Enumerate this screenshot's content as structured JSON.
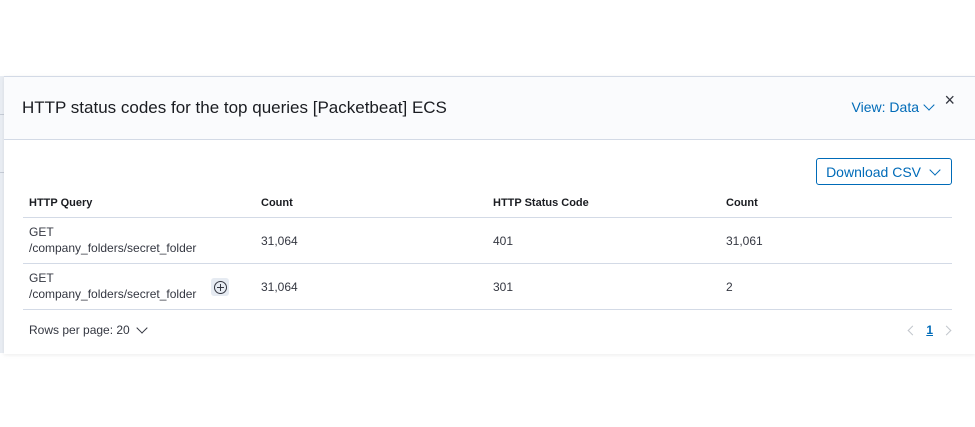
{
  "modal": {
    "title": "HTTP status codes for the top queries [Packetbeat] ECS",
    "view_toggle": "View: Data",
    "close": "×",
    "download_button": "Download CSV"
  },
  "table": {
    "headers": [
      "HTTP Query",
      "Count",
      "HTTP Status Code",
      "Count"
    ],
    "rows": [
      {
        "query_method": "GET",
        "query_path": "/company_folders/secret_folder",
        "count": "31,064",
        "status": "401",
        "status_count": "31,061"
      },
      {
        "query_method": "GET",
        "query_path": "/company_folders/secret_folder",
        "count": "31,064",
        "status": "301",
        "status_count": "2"
      }
    ]
  },
  "pagination": {
    "rows_per_page": "Rows per page: 20",
    "current_page": "1"
  },
  "colors": {
    "accent": "#006bb8",
    "border": "#d3dae6",
    "header_bg": "#fafbfd",
    "text": "#343741"
  },
  "icons": [
    "chevron-down-icon",
    "close-icon",
    "plus-in-circle-icon",
    "arrow-left-icon",
    "arrow-right-icon"
  ]
}
